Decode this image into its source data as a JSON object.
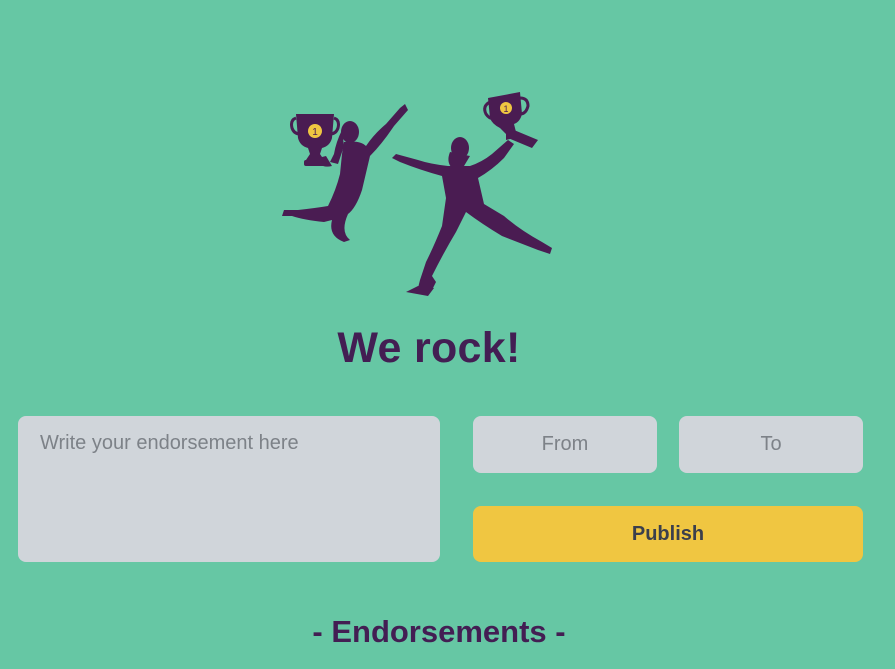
{
  "hero": {
    "icon": "trophy-celebration-icon",
    "silhouette_color": "#4a1c52",
    "trophy_badge_color": "#f0c641",
    "trophy_badge_text": "1"
  },
  "page_title": "We rock!",
  "form": {
    "endorsement_placeholder": "Write your endorsement here",
    "endorsement_value": "",
    "from_placeholder": "From",
    "from_value": "",
    "to_placeholder": "To",
    "to_value": "",
    "publish_label": "Publish"
  },
  "endorsements": {
    "heading": "- Endorsements -"
  },
  "colors": {
    "background": "#66c7a4",
    "title": "#431e53",
    "input_bg": "#d0d5da",
    "button_bg": "#f0c641"
  }
}
